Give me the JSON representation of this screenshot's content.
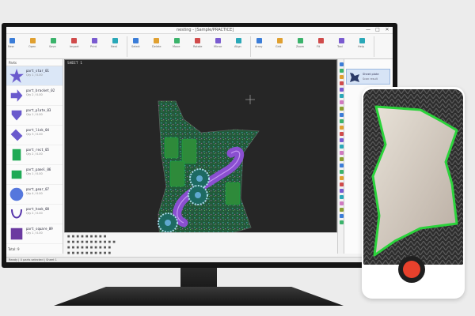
{
  "window": {
    "title": "nesting - [Sample/PRACTICE]",
    "minimize": "—",
    "maximize": "□",
    "close": "✕"
  },
  "ribbon": {
    "labels": [
      "New",
      "Open",
      "Save",
      "Import",
      "Print",
      "Nest",
      "Select",
      "Delete",
      "Move",
      "Rotate",
      "Mirror",
      "Align",
      "Array",
      "Grid",
      "Zoom",
      "Fit",
      "Tool",
      "Help"
    ]
  },
  "left_panel": {
    "header": "Parts",
    "footer": "Total: 9",
    "parts": [
      {
        "name": "part_star_01",
        "info": "Qty 1 / 0.00",
        "selected": true,
        "color": "#6a5acd"
      },
      {
        "name": "part_bracket_02",
        "info": "Qty 2 / 0.00",
        "selected": false,
        "color": "#6a5acd"
      },
      {
        "name": "part_plate_03",
        "info": "Qty 1 / 0.00",
        "selected": false,
        "color": "#6a5acd"
      },
      {
        "name": "part_link_04",
        "info": "Qty 3 / 0.00",
        "selected": false,
        "color": "#6a5acd"
      },
      {
        "name": "part_rect_05",
        "info": "Qty 2 / 0.00",
        "selected": false,
        "color": "#1faa55"
      },
      {
        "name": "part_panel_06",
        "info": "Qty 1 / 0.00",
        "selected": false,
        "color": "#1faa55"
      },
      {
        "name": "part_gear_07",
        "info": "Qty 4 / 0.00",
        "selected": false,
        "color": "#5577dd"
      },
      {
        "name": "part_hook_08",
        "info": "Qty 2 / 0.00",
        "selected": false,
        "color": "#5533aa"
      },
      {
        "name": "part_square_09",
        "info": "Qty 1 / 0.00",
        "selected": false,
        "color": "#6b3aa0"
      }
    ]
  },
  "canvas": {
    "tab_label": "SHEET 1",
    "background": "#262626"
  },
  "right_panel": {
    "item_name": "Sheet plate",
    "item_info": "Scan result"
  },
  "bottom_panel": {
    "rows": [
      "■ ■ ■ ■ ■   ■ ■ ■ ■",
      "■ ■  ■ ■ ■ ■  ■ ■  ■ ■ ■",
      "■ ■ ■ ■ ■  ■ ■ ■  ■ ■",
      "■ ■  ■ ■ ■ ■  ■ ■ ■ ■"
    ]
  },
  "status": {
    "text": "Ready  |  0 parts selected  |  Sheet 1"
  },
  "phone": {
    "detect_color": "#2bd33b",
    "shutter_color": "#e8412c"
  }
}
